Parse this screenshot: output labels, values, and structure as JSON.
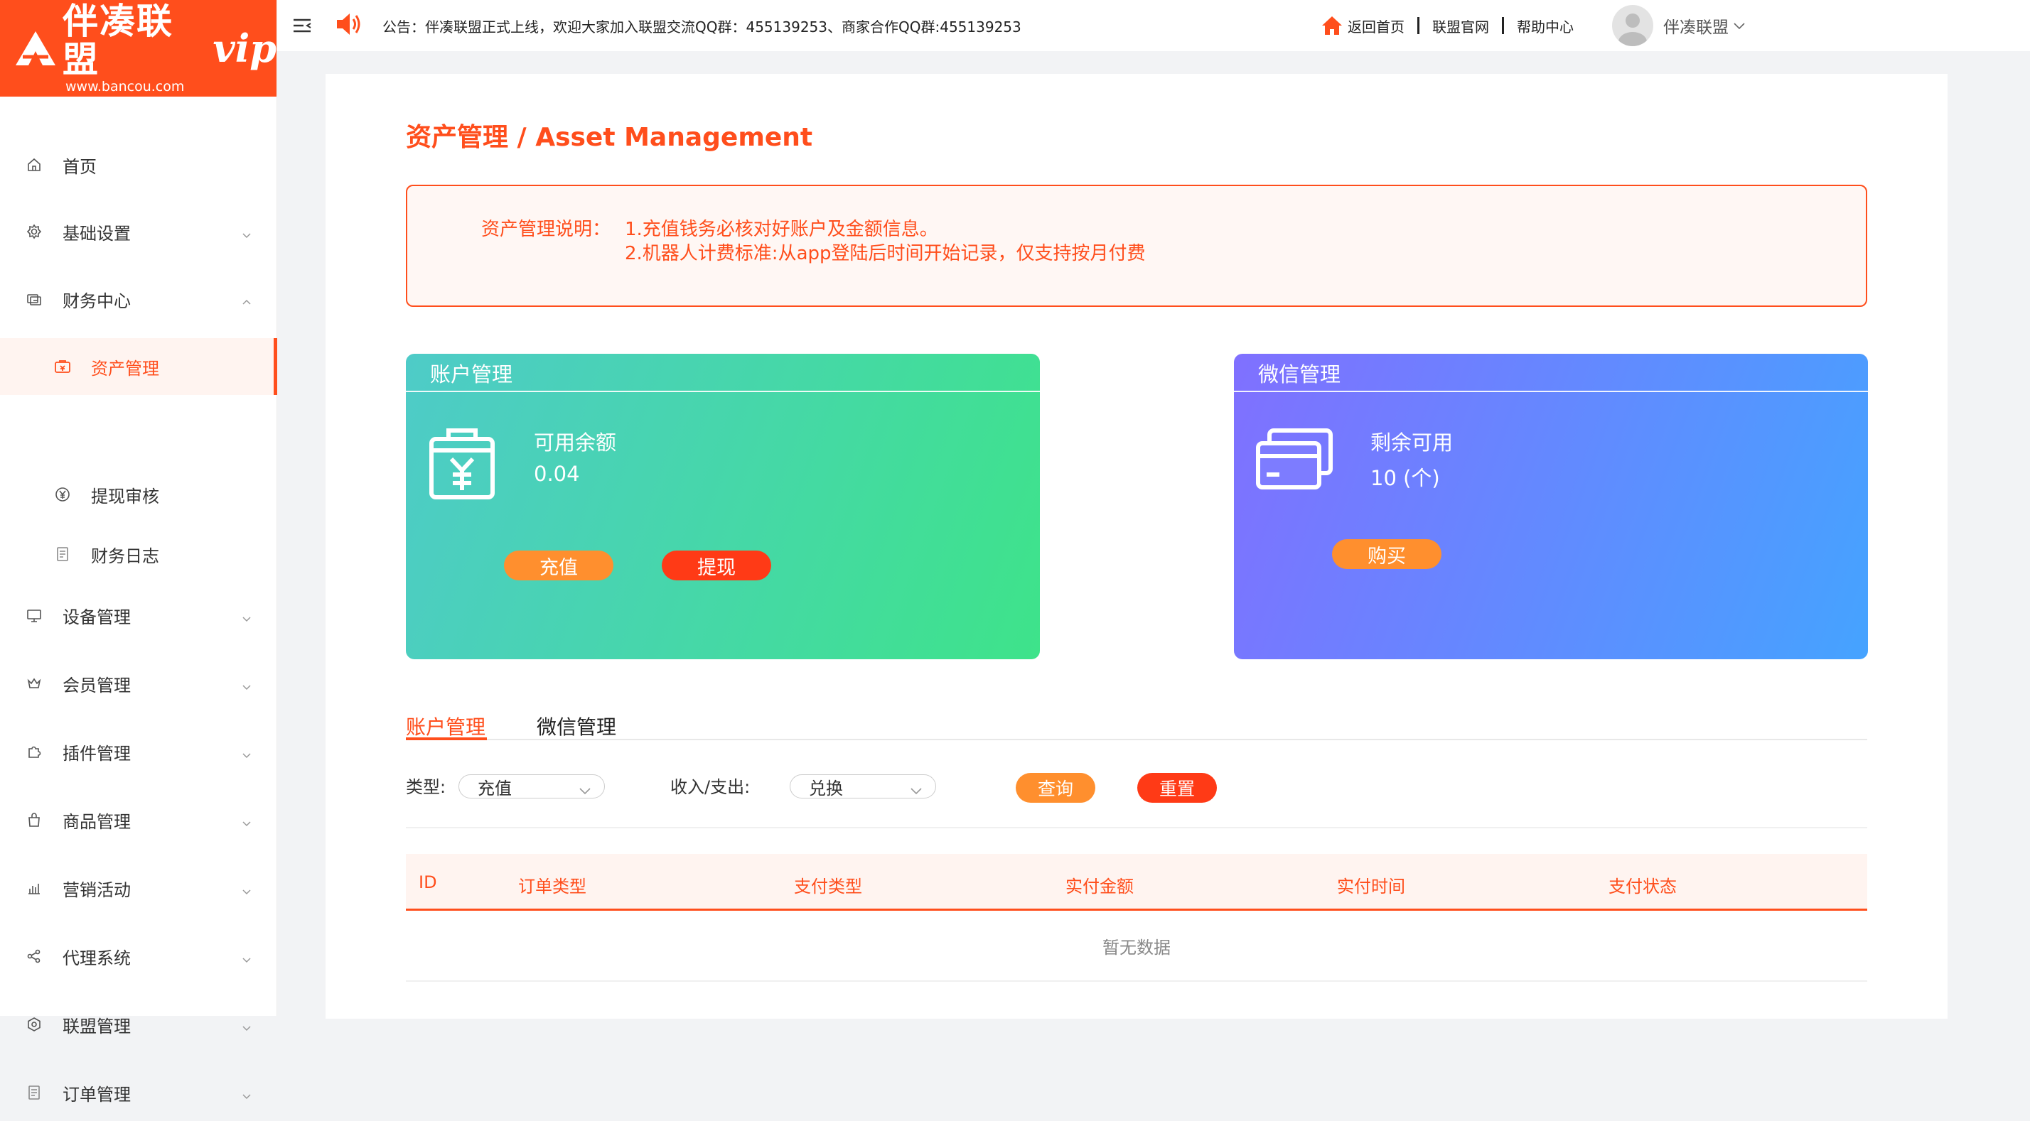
{
  "brand": {
    "name_cn": "伴凑联盟",
    "url": "www.bancou.com",
    "vip": "vip"
  },
  "colors": {
    "primary": "#ff4e1c",
    "accent_orange": "#ff8f2e",
    "card_account_gradient": [
      "#4ecbc8",
      "#3ee38a"
    ],
    "card_wechat_gradient": [
      "#8070ff",
      "#45a3ff"
    ]
  },
  "sidebar": {
    "items": [
      {
        "label": "首页",
        "icon": "home-icon",
        "expandable": false
      },
      {
        "label": "基础设置",
        "icon": "gear-icon",
        "expandable": true
      },
      {
        "label": "财务中心",
        "icon": "finance-icon",
        "expandable": true,
        "expanded": true
      },
      {
        "label": "资产管理",
        "icon": "wallet-icon",
        "sub": true,
        "active": true
      },
      {
        "label": "提现审核",
        "icon": "yen-circle-icon",
        "sub": true
      },
      {
        "label": "财务日志",
        "icon": "document-icon",
        "sub": true
      },
      {
        "label": "设备管理",
        "icon": "monitor-icon",
        "expandable": true
      },
      {
        "label": "会员管理",
        "icon": "crown-icon",
        "expandable": true
      },
      {
        "label": "插件管理",
        "icon": "puzzle-icon",
        "expandable": true
      },
      {
        "label": "商品管理",
        "icon": "bag-icon",
        "expandable": true
      },
      {
        "label": "营销活动",
        "icon": "bar-chart-icon",
        "expandable": true
      },
      {
        "label": "代理系统",
        "icon": "share-icon",
        "expandable": true
      },
      {
        "label": "联盟管理",
        "icon": "hexagon-icon",
        "expandable": true
      },
      {
        "label": "订单管理",
        "icon": "list-icon",
        "expandable": true
      }
    ]
  },
  "topbar": {
    "notice": "公告：伴凑联盟正式上线，欢迎大家加入联盟交流QQ群：455139253、商家合作QQ群:455139253",
    "links": [
      "返回首页",
      "联盟官网",
      "帮助中心"
    ],
    "user_name": "伴凑联盟"
  },
  "page": {
    "title": "资产管理 / Asset Management",
    "info_label": "资产管理说明：",
    "info_lines": [
      "1.充值钱务必核对好账户及金额信息。",
      "2.机器人计费标准:从app登陆后时间开始记录，仅支持按月付费"
    ]
  },
  "cards": {
    "account": {
      "title": "账户管理",
      "balance_label": "可用余额",
      "balance_value": "0.04",
      "recharge_label": "充值",
      "withdraw_label": "提现"
    },
    "wechat": {
      "title": "微信管理",
      "remaining_label": "剩余可用",
      "remaining_value": "10 (个)",
      "buy_label": "购买"
    }
  },
  "tabs": [
    {
      "label": "账户管理",
      "active": true
    },
    {
      "label": "微信管理",
      "active": false
    }
  ],
  "filters": {
    "type_label": "类型:",
    "type_value": "充值",
    "io_label": "收入/支出:",
    "io_value": "兑换",
    "query_label": "查询",
    "reset_label": "重置"
  },
  "table": {
    "columns": [
      "ID",
      "订单类型",
      "支付类型",
      "实付金额",
      "实付时间",
      "支付状态"
    ],
    "rows": [],
    "empty_text": "暂无数据"
  }
}
